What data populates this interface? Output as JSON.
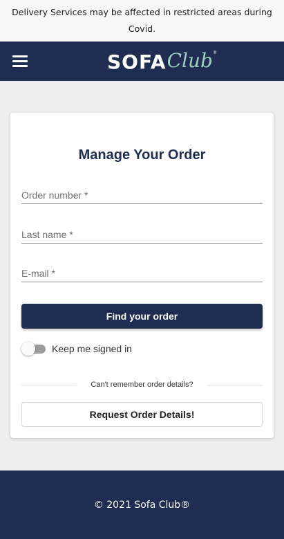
{
  "banner": {
    "text": "Delivery Services may be affected in restricted areas during Covid."
  },
  "navbar": {
    "menu_icon": "hamburger-menu-icon",
    "logo": {
      "word_sofa": "SOFA",
      "word_club": "Club",
      "reg_mark": "®"
    },
    "colors": {
      "background": "#1f2d52",
      "logo_accent": "#9fd0c2"
    }
  },
  "card": {
    "title": "Manage Your Order",
    "fields": {
      "order_number": {
        "placeholder": "Order number *",
        "value": ""
      },
      "last_name": {
        "placeholder": "Last name *",
        "value": ""
      },
      "email": {
        "placeholder": "E-mail *",
        "value": ""
      }
    },
    "find_button_label": "Find your order",
    "keep_signed_in": {
      "label": "Keep me signed in",
      "checked": false
    },
    "divider_text": "Can't remember order details?",
    "request_button_label": "Request Order Details!"
  },
  "footer": {
    "copyright": "© 2021 Sofa Club®"
  }
}
